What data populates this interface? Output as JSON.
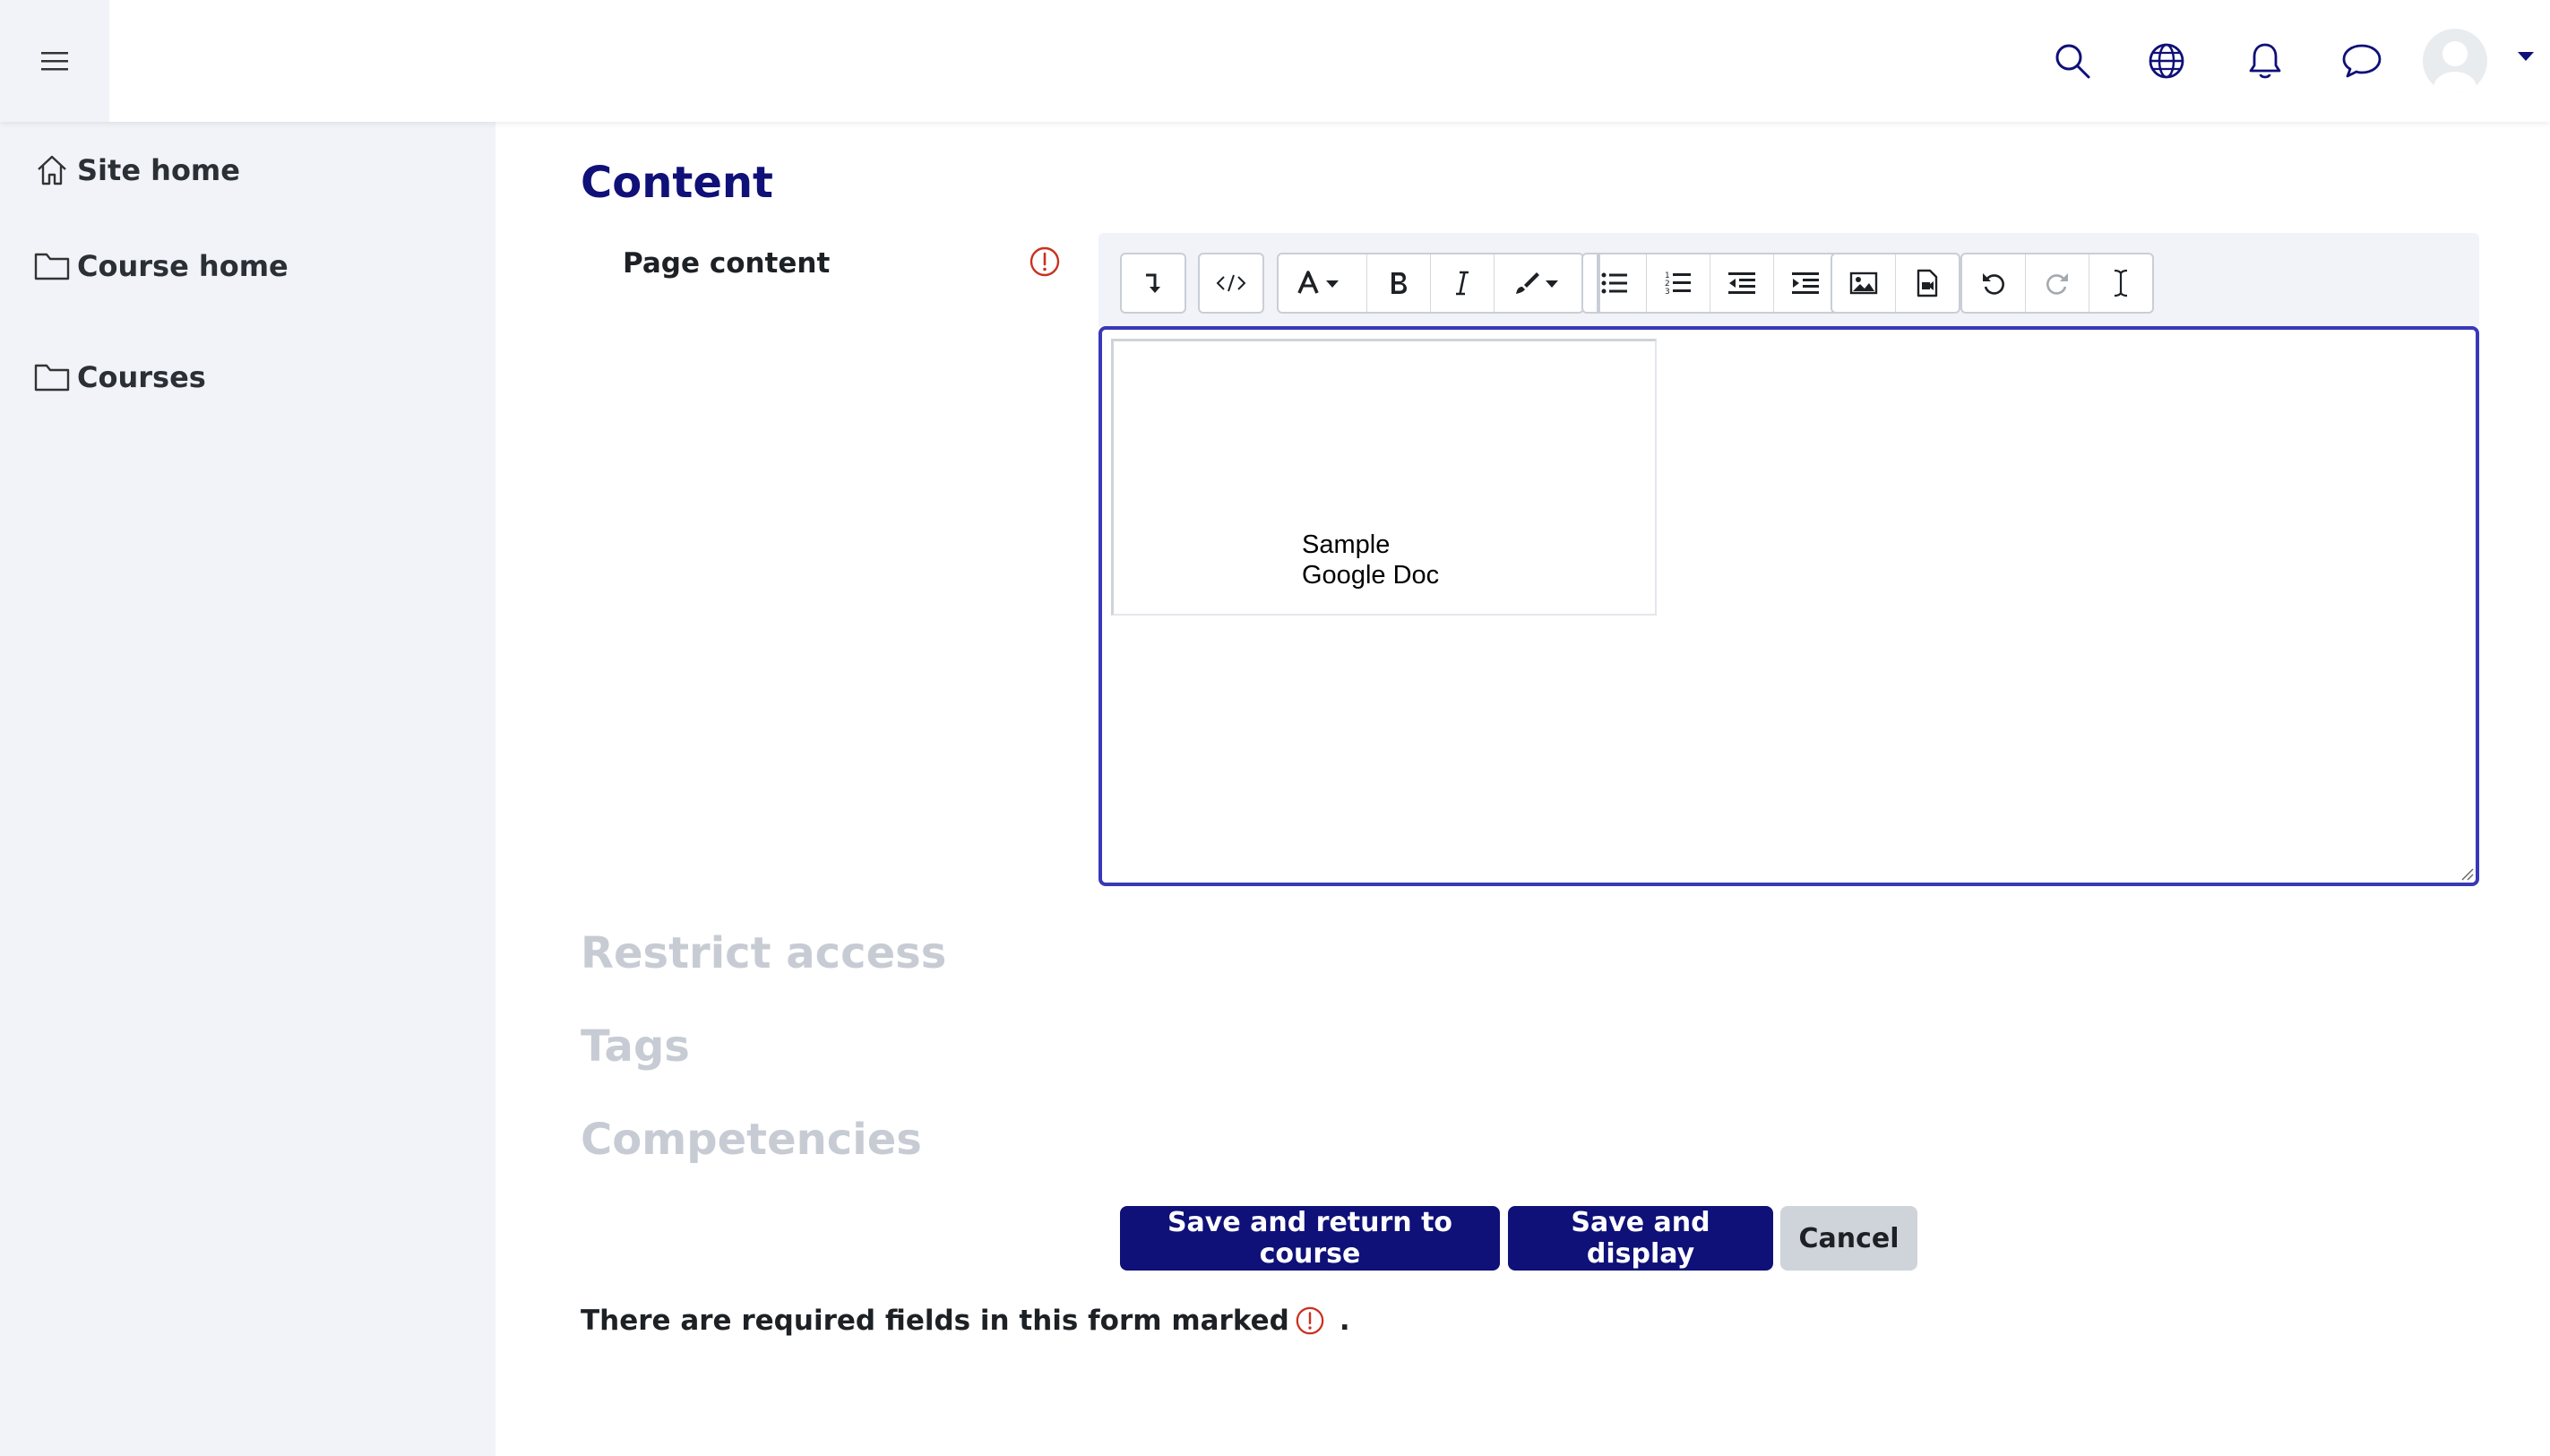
{
  "topbar": {
    "icons": [
      "menu-icon",
      "search-icon",
      "globe-icon",
      "bell-icon",
      "chat-icon",
      "user-avatar",
      "caret-down-icon"
    ]
  },
  "sidebar": {
    "items": [
      {
        "label": "Site home",
        "icon": "home-icon"
      },
      {
        "label": "Course home",
        "icon": "folder-icon"
      },
      {
        "label": "Courses",
        "icon": "folder-icon"
      }
    ]
  },
  "main": {
    "section_title": "Content",
    "field_label": "Page content",
    "editor": {
      "toolbar_buttons": [
        "collapse",
        "html",
        "font-style",
        "bold",
        "italic",
        "text-color",
        "unordered-list",
        "ordered-list",
        "outdent",
        "indent",
        "image",
        "media",
        "undo",
        "redo",
        "clear-formatting"
      ],
      "doc_line1": "Sample",
      "doc_line2": "Google Doc"
    },
    "collapsed_sections": [
      "Restrict access",
      "Tags",
      "Competencies"
    ],
    "buttons": {
      "save_return": "Save and return to course",
      "save_display": "Save and display",
      "cancel": "Cancel"
    },
    "required_note": "There are required fields in this form marked",
    "required_note_suffix": "."
  },
  "colors": {
    "brand": "#0f1078",
    "editor_border": "#3838b8",
    "required": "#ca3120",
    "sidebar_bg": "#f1f3f8"
  }
}
